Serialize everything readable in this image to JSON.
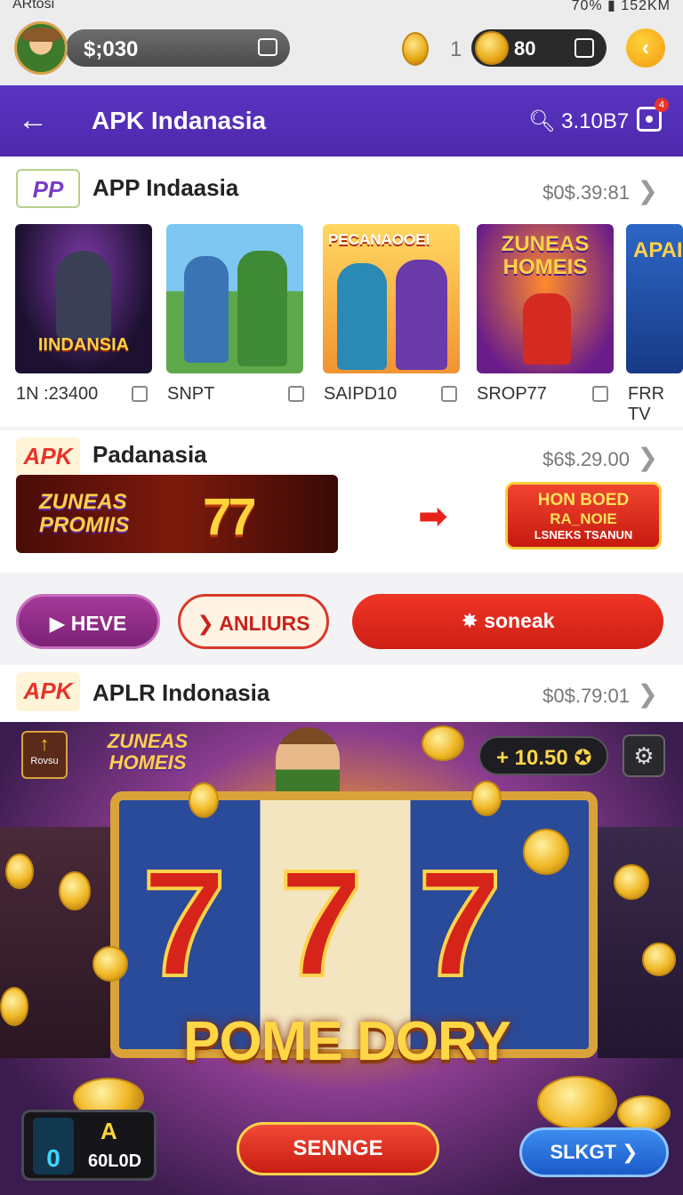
{
  "status": {
    "left": "ARtosi",
    "right": "70% ▮ 152KM"
  },
  "top": {
    "balance": "$;030",
    "coin_count": "1",
    "coin_pill": "80"
  },
  "appbar": {
    "back": "←",
    "title": "APK Indanasia",
    "search_value": "3.10B7",
    "badge": "4"
  },
  "section1": {
    "title": "APP Indaasia",
    "price": "$0$.39:81",
    "cards": [
      {
        "art": "IINDANSIA",
        "label": "1N :23400"
      },
      {
        "art": "",
        "label": "SNPT"
      },
      {
        "art": "PECANAOOEI",
        "label": "SAIPD10"
      },
      {
        "art": "ZUNEAS HOMEIS",
        "label": "SROP77"
      },
      {
        "art": "APAI",
        "label": "FRR TV"
      }
    ]
  },
  "section2": {
    "logo": "APK",
    "title": "Padanasia",
    "price": "$6$.29.00",
    "banner_logo": "ZUNEAS PROMIIS",
    "banner_num": "77",
    "cta_line1": "HON BOED",
    "cta_line2": "RA_NOIE",
    "cta_line3": "LSNEKS TSANUN"
  },
  "actions": {
    "btn1": "▶ HEVE",
    "btn2": "❯ ANLIURS",
    "btn3": "✸ soneak"
  },
  "section3": {
    "logo": "APK",
    "title": "APLR Indonasia",
    "price": "$0$.79:01"
  },
  "game": {
    "logo": "ZUNEAS HOMEIS",
    "up_label": "Rovsu",
    "score": "+ 10.50 ✪",
    "reel1": "7",
    "reel2": "7",
    "reel3": "7",
    "headline": "POME DORY",
    "stat_left": "0",
    "stat_right_top": "A",
    "stat_right": "60L0D",
    "btn_center": "SENNGE",
    "btn_right": "SLKGT ❯"
  }
}
